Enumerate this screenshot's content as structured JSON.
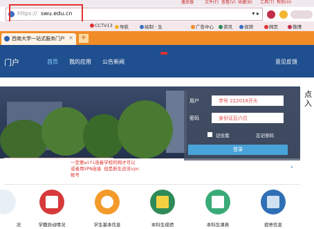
{
  "browser": {
    "menu": [
      "播放器",
      "文件(F)",
      "查看(V)",
      "收藏(B)",
      "工具(T)",
      "帮助(H)"
    ],
    "address": {
      "protocol": "https://",
      "host": "swu.edu.cn"
    },
    "bookmarks": [
      "CCTV13",
      "导航",
      "绘制 · 生",
      "广告中心",
      "资讯",
      "视频",
      "网页",
      "微博"
    ],
    "tab": {
      "title": "西南大学一站式服务门户",
      "close": "×",
      "new": "+"
    }
  },
  "site": {
    "portal": "门户",
    "nav": [
      "首页",
      "我的应用",
      "公告新闻"
    ],
    "feedback": "意见反馈"
  },
  "login": {
    "user_label": "用户",
    "password_label": "密码",
    "user_placeholder": "学号 222018开头",
    "password_placeholder": "身份证后六位",
    "remember": "记住我",
    "forgot": "忘记密码",
    "submit": "登录"
  },
  "side_text": [
    "点",
    "入"
  ],
  "notice": [
    "一定要wifi连着学校的网才可以",
    "或者用VPN连接 但是新生还没vpn",
    "帐号"
  ],
  "apps": [
    {
      "label": "况",
      "color": "#ffffff"
    },
    {
      "label": "学籍异动情况",
      "color": "#d63a3a"
    },
    {
      "label": "学生基本信息",
      "color": "#f39a2a"
    },
    {
      "label": "本科生成绩",
      "color": "#2e8b57"
    },
    {
      "label": "本科生课表",
      "color": "#3aaa78"
    },
    {
      "label": "宿舍信息",
      "color": "#2f6fb5"
    }
  ]
}
